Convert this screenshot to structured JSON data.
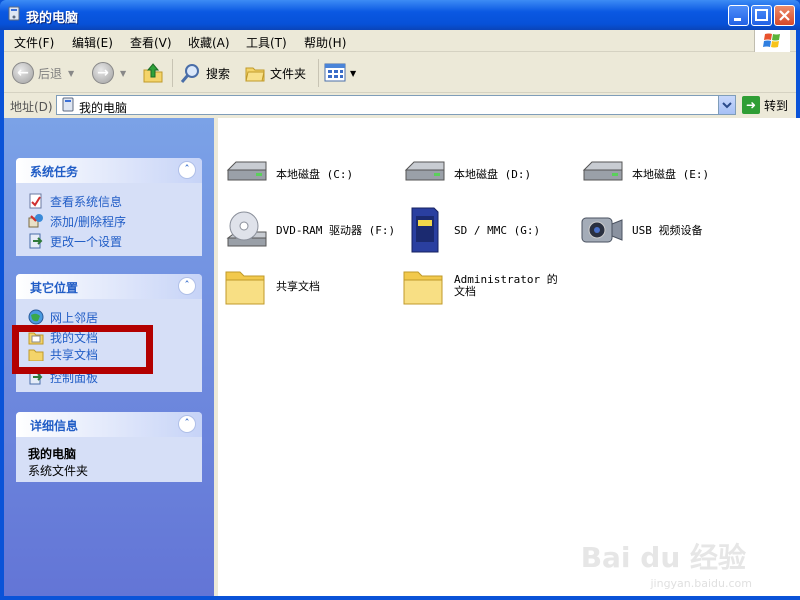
{
  "window": {
    "title": "我的电脑"
  },
  "menu": [
    "文件(F)",
    "编辑(E)",
    "查看(V)",
    "收藏(A)",
    "工具(T)",
    "帮助(H)"
  ],
  "toolbar": {
    "back": "后退",
    "search": "搜索",
    "folders": "文件夹"
  },
  "address": {
    "label": "地址(D)",
    "value": "我的电脑",
    "go": "转到"
  },
  "panels": {
    "system_tasks": {
      "title": "系统任务",
      "items": [
        "查看系统信息",
        "添加/删除程序",
        "更改一个设置"
      ]
    },
    "other_places": {
      "title": "其它位置",
      "items": [
        "网上邻居",
        "我的文档",
        "共享文档",
        "控制面板"
      ]
    },
    "details": {
      "title": "详细信息",
      "name": "我的电脑",
      "type": "系统文件夹"
    }
  },
  "items": [
    {
      "label": "本地磁盘 (C:)",
      "icon": "hard-drive-icon"
    },
    {
      "label": "本地磁盘 (D:)",
      "icon": "hard-drive-icon"
    },
    {
      "label": "本地磁盘 (E:)",
      "icon": "hard-drive-icon"
    },
    {
      "label": "DVD-RAM 驱动器 (F:)",
      "icon": "dvd-drive-icon"
    },
    {
      "label": "SD / MMC (G:)",
      "icon": "sd-card-icon"
    },
    {
      "label": "USB 视频设备",
      "icon": "camera-icon"
    },
    {
      "label": "共享文档",
      "icon": "folder-icon"
    },
    {
      "label": "Administrator 的文档",
      "icon": "folder-icon"
    }
  ],
  "watermark": {
    "brand": "Bai du 经验",
    "url": "jingyan.baidu.com"
  },
  "colors": {
    "highlight": "#b30000",
    "link": "#215dc6",
    "titlebar": "#0a58e2"
  }
}
